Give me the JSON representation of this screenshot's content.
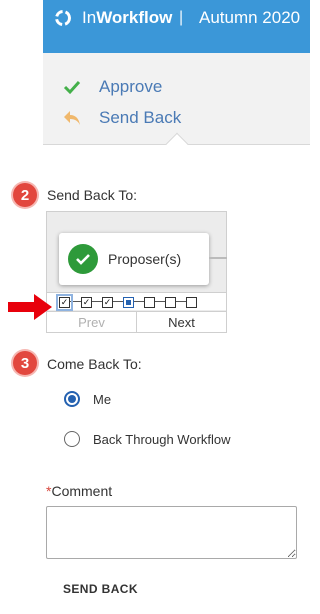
{
  "header": {
    "brand_prefix": "In",
    "brand_bold": "Workflow",
    "separator": "|",
    "term": "Autumn 2020",
    "icon": "refresh-circle-icon",
    "background": "#3b97d8"
  },
  "actions": [
    {
      "label": "Approve",
      "icon": "check-icon",
      "color": "#44b04a"
    },
    {
      "label": "Send Back",
      "icon": "reply-arrow-icon",
      "color": "#f0b86c"
    }
  ],
  "send_back_to": {
    "step_number": "2",
    "label": "Send Back To:",
    "tooltip_text": "Proposer(s)",
    "stepper": {
      "steps": [
        {
          "state": "checked",
          "selected": true
        },
        {
          "state": "checked"
        },
        {
          "state": "checked"
        },
        {
          "state": "current"
        },
        {
          "state": "empty"
        },
        {
          "state": "empty"
        },
        {
          "state": "empty"
        }
      ]
    },
    "prev_label": "Prev",
    "next_label": "Next"
  },
  "come_back_to": {
    "step_number": "3",
    "label": "Come Back To:",
    "options": [
      {
        "label": "Me",
        "selected": true
      },
      {
        "label": "Back Through Workflow",
        "selected": false
      }
    ]
  },
  "comment": {
    "required_mark": "*",
    "label": "Comment",
    "value": ""
  },
  "submit_label": "SEND BACK",
  "colors": {
    "badge": "#e2473e",
    "pointer_arrow": "#e8000b",
    "accent": "#2461b0"
  }
}
